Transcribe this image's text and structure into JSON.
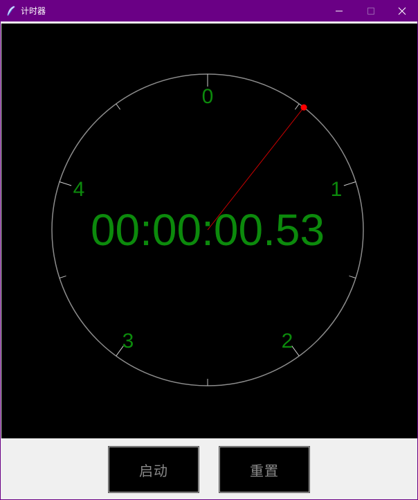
{
  "window": {
    "title": "计时器"
  },
  "clock": {
    "time": "00:00:00.53",
    "dial_labels": [
      "0",
      "1",
      "2",
      "3",
      "4"
    ],
    "hand_fraction": 0.106,
    "colors": {
      "background": "#000000",
      "dial": "#8c8c8c",
      "text": "#0c8a0c",
      "hand": "#cc0000"
    }
  },
  "controls": {
    "start_label": "启动",
    "reset_label": "重置"
  }
}
